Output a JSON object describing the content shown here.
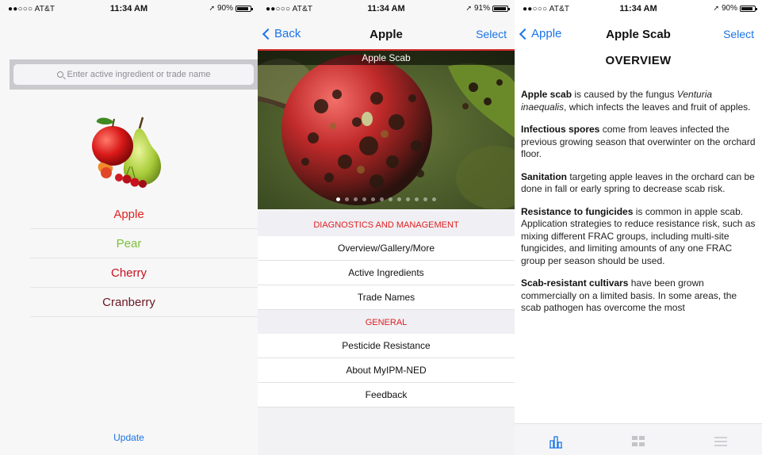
{
  "screens": {
    "crop_select": {
      "status": {
        "carrier": "●●○○○ AT&T",
        "time": "11:34 AM",
        "battery": "90%",
        "battery_level": 0.9
      },
      "search": {
        "placeholder": "Enter active ingredient or trade name"
      },
      "crops": [
        {
          "label": "Apple",
          "color": "#e02020"
        },
        {
          "label": "Pear",
          "color": "#7cbf3a"
        },
        {
          "label": "Cherry",
          "color": "#c8101e"
        },
        {
          "label": "Cranberry",
          "color": "#6b1620"
        }
      ],
      "update_label": "Update"
    },
    "disease_menu": {
      "status": {
        "carrier": "●●○○○ AT&T",
        "time": "11:34 AM",
        "battery": "91%",
        "battery_level": 0.91
      },
      "nav": {
        "back": "Back",
        "title": "Apple",
        "action": "Select"
      },
      "hero_caption": "Apple Scab",
      "gallery_page": 1,
      "gallery_pages": 12,
      "sections": [
        {
          "header": "DIAGNOSTICS AND MANAGEMENT",
          "items": [
            "Overview/Gallery/More",
            "Active Ingredients",
            "Trade Names"
          ]
        },
        {
          "header": "GENERAL",
          "items": [
            "Pesticide Resistance",
            "About MyIPM-NED",
            "Feedback"
          ]
        }
      ]
    },
    "overview": {
      "status": {
        "carrier": "●●○○○ AT&T",
        "time": "11:34 AM",
        "battery": "90%",
        "battery_level": 0.9
      },
      "nav": {
        "back": "Apple",
        "title": "Apple Scab",
        "action": "Select"
      },
      "heading": "OVERVIEW",
      "paragraphs": [
        {
          "bold": "Apple scab",
          "text": " is caused by the fungus ",
          "italic": "Venturia inaequalis",
          "tail": ", which infects the leaves and fruit of apples."
        },
        {
          "bold": "Infectious spores",
          "text": " come from leaves infected the previous growing season that overwinter on the orchard floor.",
          "italic": "",
          "tail": ""
        },
        {
          "bold": "Sanitation",
          "text": " targeting apple leaves in the orchard can be done in fall or early spring to decrease scab risk.",
          "italic": "",
          "tail": ""
        },
        {
          "bold": "Resistance to fungicides",
          "text": " is common in apple scab. Application strategies to reduce resistance risk, such as mixing different FRAC groups, including multi-site fungicides, and limiting amounts of any one FRAC group per season should be used.",
          "italic": "",
          "tail": ""
        },
        {
          "bold": "Scab-resistant cultivars",
          "text": " have been grown commercially on a limited basis. In some areas, the scab pathogen has overcome the most",
          "italic": "",
          "tail": ""
        }
      ],
      "tabs": [
        {
          "icon": "chart-icon",
          "active": true
        },
        {
          "icon": "gallery-icon",
          "active": false
        },
        {
          "icon": "list-icon",
          "active": false
        }
      ]
    }
  },
  "colors": {
    "accent": "#1a74e8",
    "section_red": "#e02020",
    "hero_border": "#d42a2a"
  }
}
